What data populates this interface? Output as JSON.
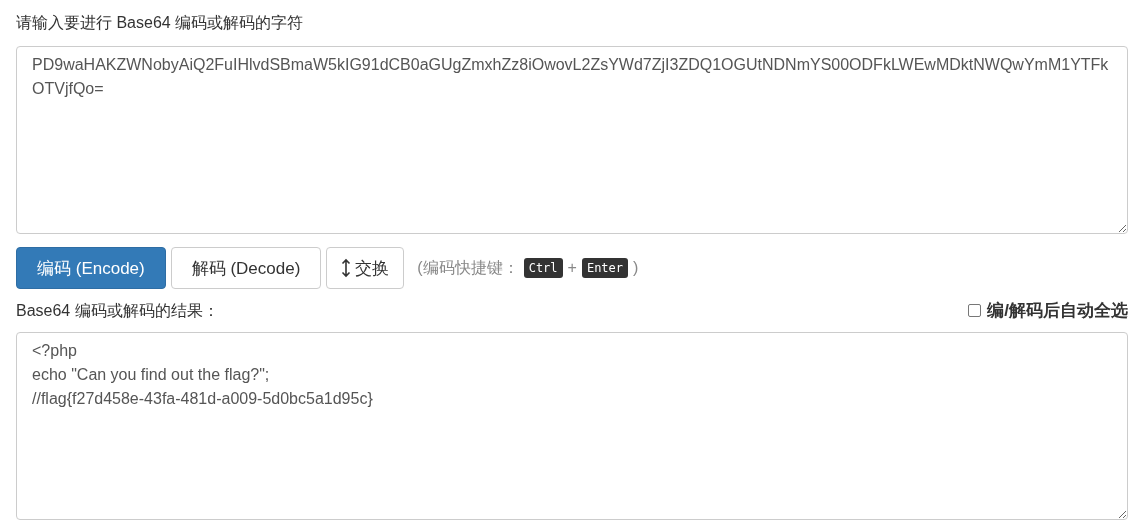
{
  "input": {
    "label": "请输入要进行 Base64 编码或解码的字符",
    "value": "PD9waHAKZWNobyAiQ2FuIHlvdSBmaW5kIG91dCB0aGUgZmxhZz8iOwovL2ZsYWd7ZjI3ZDQ1OGUtNDNmYS00ODFkLWEwMDktNWQwYmM1YTFkOTVjfQo="
  },
  "buttons": [
    {
      "kind": "primary",
      "label": "编码 (Encode)"
    },
    {
      "kind": "default",
      "label": "解码 (Decode)"
    },
    {
      "kind": "swap",
      "label": "交换"
    }
  ],
  "shortcut_hint": {
    "open": "(编码快捷键：",
    "keys": [
      "Ctrl",
      "Enter"
    ],
    "joiner": "+",
    "close": ")"
  },
  "output": {
    "label": "Base64 编码或解码的结果：",
    "value": "<?php\necho \"Can you find out the flag?\";\n//flag{f27d458e-43fa-481d-a009-5d0bc5a1d95c}"
  },
  "auto_select": {
    "label": "编/解码后自动全选",
    "checked": false
  }
}
